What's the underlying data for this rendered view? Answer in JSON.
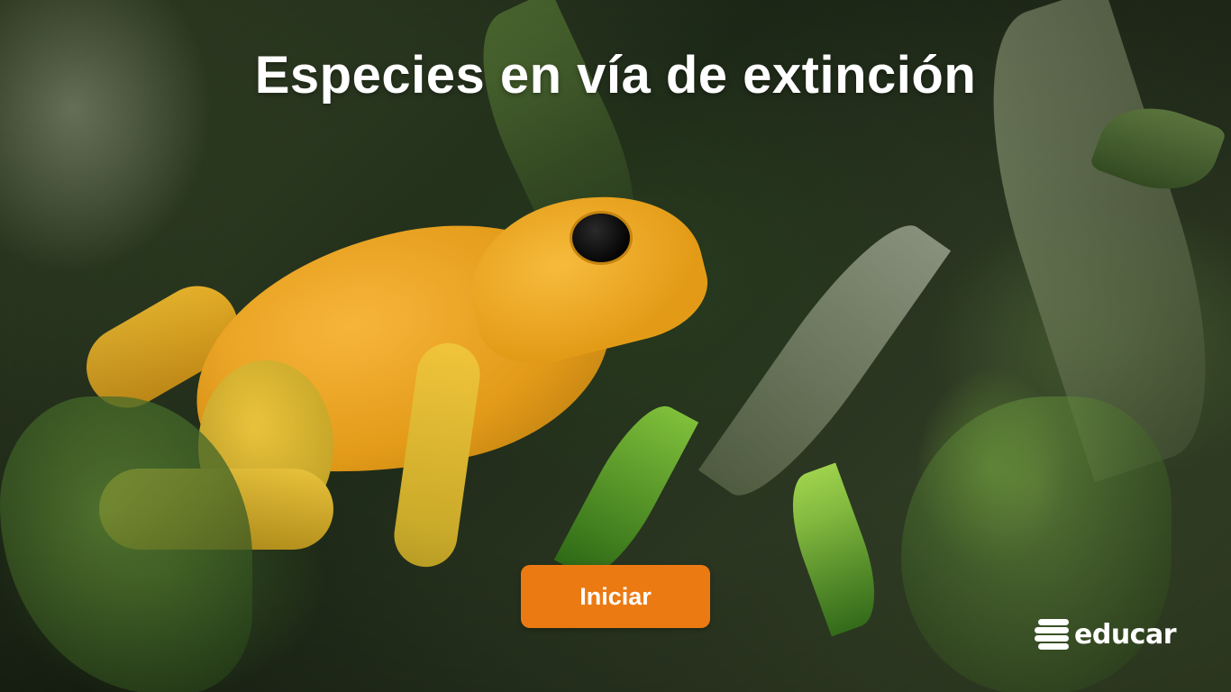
{
  "screen": {
    "title": "Especies en vía de extinción",
    "start_button_label": "Iniciar"
  },
  "brand": {
    "logo_text": "educar",
    "logo_icon": "educar-stripes-icon",
    "accent_color": "#ec7a12"
  },
  "background": {
    "image_subject": "yellow-frog-photo"
  }
}
